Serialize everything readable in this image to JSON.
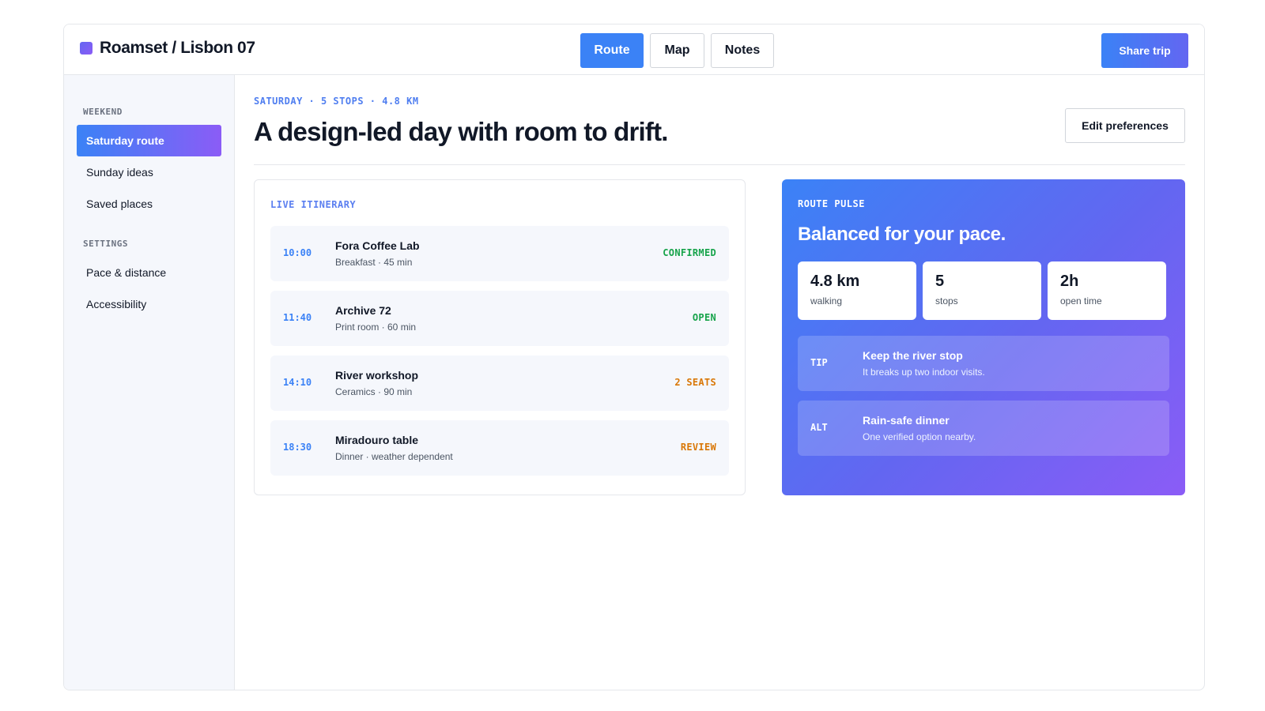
{
  "app": {
    "title": "Roamset / Lisbon 07"
  },
  "header": {
    "tabs": [
      {
        "label": "Route",
        "active": true
      },
      {
        "label": "Map",
        "active": false
      },
      {
        "label": "Notes",
        "active": false
      }
    ],
    "share_label": "Share trip"
  },
  "sidebar": {
    "sections": [
      {
        "heading": "WEEKEND",
        "items": [
          {
            "label": "Saturday route",
            "active": true
          },
          {
            "label": "Sunday ideas",
            "active": false
          },
          {
            "label": "Saved places",
            "active": false
          }
        ]
      },
      {
        "heading": "SETTINGS",
        "items": [
          {
            "label": "Pace & distance",
            "active": false
          },
          {
            "label": "Accessibility",
            "active": false
          }
        ]
      }
    ]
  },
  "main": {
    "eyebrow": "SATURDAY · 5 STOPS · 4.8 KM",
    "headline": "A design-led day with room to drift.",
    "edit_label": "Edit preferences"
  },
  "itinerary": {
    "label": "LIVE ITINERARY",
    "stops": [
      {
        "time": "10:00",
        "name": "Fora Coffee Lab",
        "meta": "Breakfast · 45 min",
        "status": "CONFIRMED",
        "status_color": "#16a34a"
      },
      {
        "time": "11:40",
        "name": "Archive 72",
        "meta": "Print room · 60 min",
        "status": "OPEN",
        "status_color": "#16a34a"
      },
      {
        "time": "14:10",
        "name": "River workshop",
        "meta": "Ceramics · 90 min",
        "status": "2 SEATS",
        "status_color": "#d97706"
      },
      {
        "time": "18:30",
        "name": "Miradouro table",
        "meta": "Dinner · weather dependent",
        "status": "REVIEW",
        "status_color": "#d97706"
      }
    ]
  },
  "pulse": {
    "label": "ROUTE PULSE",
    "title": "Balanced for your pace.",
    "stats": [
      {
        "value": "4.8 km",
        "label": "walking"
      },
      {
        "value": "5",
        "label": "stops"
      },
      {
        "value": "2h",
        "label": "open time"
      }
    ],
    "notes": [
      {
        "tag": "TIP",
        "title": "Keep the river stop",
        "sub": "It breaks up two indoor visits."
      },
      {
        "tag": "ALT",
        "title": "Rain-safe dinner",
        "sub": "One verified option nearby."
      }
    ]
  },
  "colors": {
    "accent": "#3b82f6",
    "accent_secondary": "#8b5cf6",
    "confirmed": "#16a34a",
    "warning": "#d97706"
  }
}
